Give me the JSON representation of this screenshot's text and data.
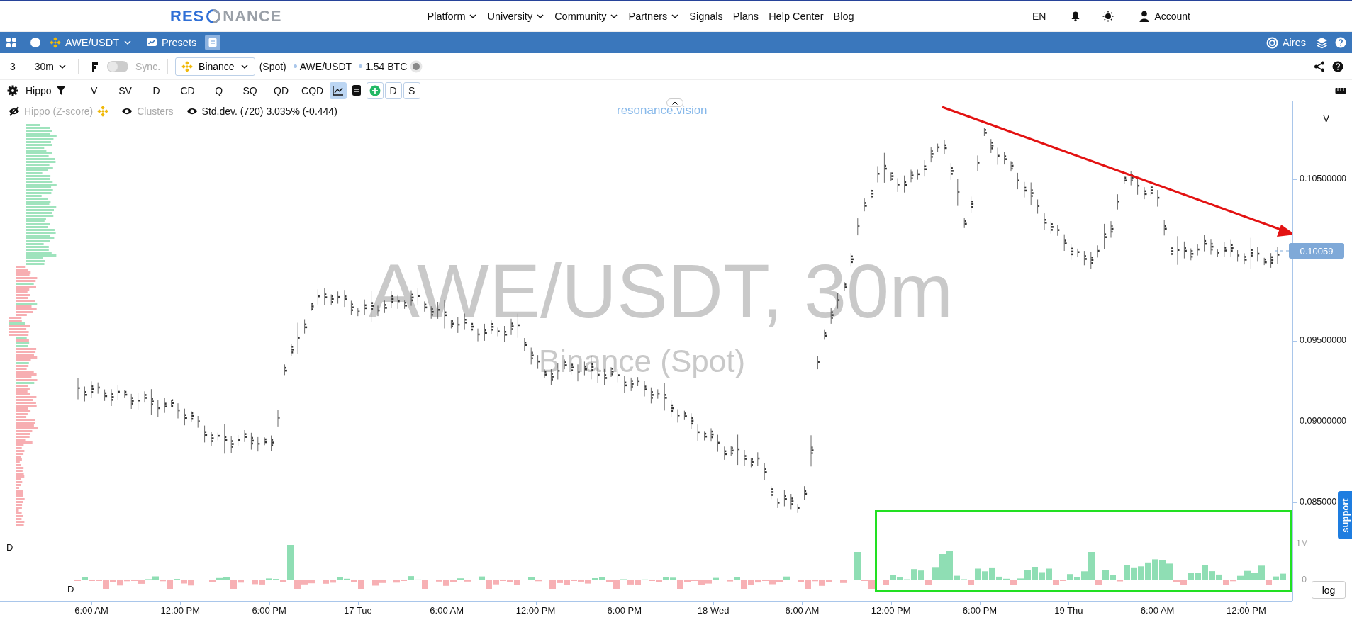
{
  "nav": {
    "logo": [
      "RES",
      "NANCE"
    ],
    "items": [
      {
        "label": "Platform",
        "kind": "menu"
      },
      {
        "label": "University",
        "kind": "menu"
      },
      {
        "label": "Community",
        "kind": "menu"
      },
      {
        "label": "Partners",
        "kind": "menu"
      },
      {
        "label": "Signals",
        "kind": "link"
      },
      {
        "label": "Plans",
        "kind": "link"
      },
      {
        "label": "Help Center",
        "kind": "link"
      },
      {
        "label": "Blog",
        "kind": "link"
      }
    ],
    "language": "EN",
    "account": "Account"
  },
  "symbol_bar": {
    "symbol": "AWE/USDT",
    "presets": "Presets",
    "assistant": "Aires"
  },
  "chart_toolbar": {
    "layout_count": "3",
    "interval": "30m",
    "sync": {
      "label": "Sync.",
      "on": false
    },
    "exchange": "Binance",
    "market": "(Spot)",
    "pair": "AWE/USDT",
    "volume": "1.54 BTC"
  },
  "indicator_bar": {
    "preset": "Hippo",
    "indicators": [
      {
        "label": "V",
        "selected": false
      },
      {
        "label": "SV",
        "selected": false
      },
      {
        "label": "D",
        "selected": false
      },
      {
        "label": "CD",
        "selected": false
      },
      {
        "label": "Q",
        "selected": false
      },
      {
        "label": "SQ",
        "selected": false
      },
      {
        "label": "QD",
        "selected": false
      },
      {
        "label": "CQD",
        "selected": false
      }
    ],
    "tools": [
      {
        "kind": "line-chart",
        "selected": true
      },
      {
        "kind": "document",
        "selected": false
      },
      {
        "kind": "add",
        "selected": false
      },
      {
        "kind": "letter",
        "label": "D",
        "selected": false
      },
      {
        "kind": "letter",
        "label": "S",
        "selected": false
      }
    ]
  },
  "legend": [
    {
      "label": "Hippo (Z-score)",
      "visible": false,
      "dimmed": true,
      "exchange_icon": true
    },
    {
      "label": "Clusters",
      "visible": true,
      "dimmed": true,
      "exchange_icon": false
    },
    {
      "label": "Std.dev. (720) 3.035% (-0.444)",
      "visible": true,
      "dimmed": false,
      "exchange_icon": false
    }
  ],
  "chart": {
    "brand": "resonance.vision",
    "watermark": "AWE/USDT, 30m",
    "watermark_sub": "Binance (Spot)",
    "axis_title": "V",
    "price_ticks": [
      "0.10500000",
      "0.09500000",
      "0.09000000",
      "0.085000"
    ],
    "last_price": "0.10059",
    "pane_label": "D",
    "delta_label": "D",
    "delta_ticks": [
      "1M",
      "0"
    ],
    "time_ticks": [
      "6:00 AM",
      "12:00 PM",
      "6:00 PM",
      "17 Tue",
      "6:00 AM",
      "12:00 PM",
      "6:00 PM",
      "18 Wed",
      "6:00 AM",
      "12:00 PM",
      "6:00 PM",
      "19 Thu",
      "6:00 AM",
      "12:00 PM"
    ],
    "scale_button": "log",
    "trend_arrow": true,
    "highlight_frame": true
  },
  "support_tab": "support"
}
